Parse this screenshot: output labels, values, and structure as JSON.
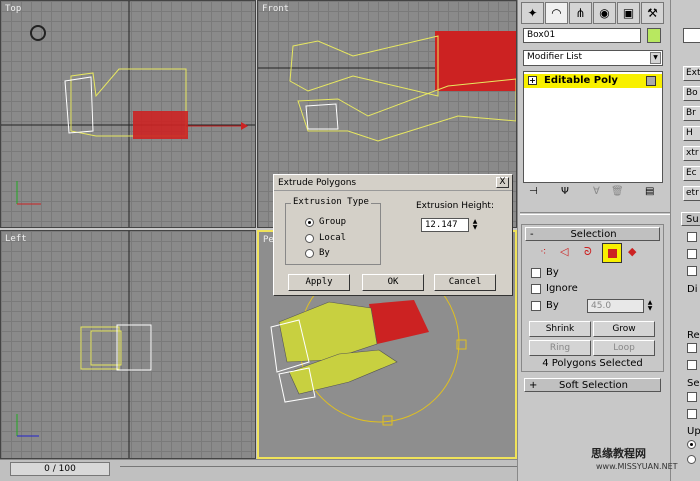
{
  "viewports": {
    "top": "Top",
    "front": "Front",
    "left": "Left",
    "perspective": "Pe"
  },
  "timeline": {
    "frame": "0 / 100"
  },
  "command_panel": {
    "object_name": "Box01",
    "modifier_list": "Modifier List",
    "stack_item": "Editable Poly",
    "selection_header": "Selection",
    "by_label_1": "By",
    "ignore_label": "Ignore",
    "by_label_2": "By",
    "angle_value": "45.0",
    "shrink": "Shrink",
    "grow": "Grow",
    "ring": "Ring",
    "loop": "Loop",
    "status": "4 Polygons Selected",
    "soft_selection": "Soft Selection"
  },
  "right_strip": {
    "items": [
      "Ext",
      "Bo",
      "Br",
      "H",
      "xtr",
      "Ec",
      "etr"
    ],
    "sub": "Su",
    "di": "Di",
    "re": "Re",
    "se": "Se",
    "up": "Up"
  },
  "dialog": {
    "title": "Extrude Polygons",
    "close": "X",
    "group_title": "Extrusion Type",
    "options": [
      "Group",
      "Local",
      "By"
    ],
    "height_label": "Extrusion Height:",
    "height_value": "12.147",
    "apply": "Apply",
    "ok": "OK",
    "cancel": "Cancel"
  },
  "watermark": {
    "line1": "思缘教程网",
    "line2": "www.MISSYUAN.NET"
  },
  "colors": {
    "selection": "#cc2222",
    "wire": "#e8e860",
    "active_border": "#f0e35a",
    "stack_highlight": "#f8f000"
  }
}
